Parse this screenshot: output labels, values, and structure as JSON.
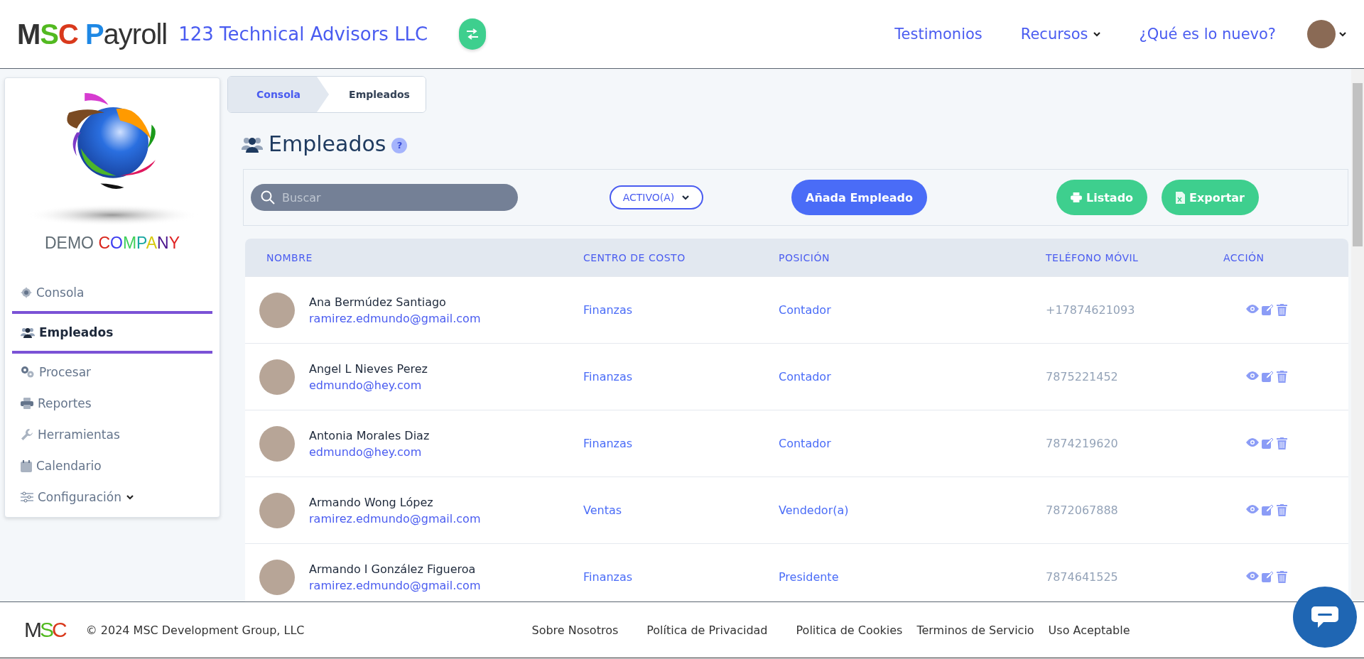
{
  "header": {
    "logo_parts": [
      {
        "text": "M",
        "color": "#333333"
      },
      {
        "text": "S",
        "color": "#52b920"
      },
      {
        "text": "C",
        "color": "#d9391c"
      },
      {
        "text": "P",
        "color": "#1e88e5"
      },
      {
        "text": "ayroll",
        "color": "#333333"
      }
    ],
    "company": "123 Technical Advisors LLC",
    "nav": [
      {
        "label": "Testimonios",
        "has_menu": false
      },
      {
        "label": "Recursos",
        "has_menu": true
      },
      {
        "label": "¿Qué es lo nuevo?",
        "has_menu": false
      }
    ]
  },
  "sidebar": {
    "brand_parts": [
      {
        "text": "DEMO ",
        "color": "#5f6b73"
      },
      {
        "text": "C",
        "color": "#d9251c"
      },
      {
        "text": "O",
        "color": "#3b3bf0"
      },
      {
        "text": "M",
        "color": "#3fcf5a"
      },
      {
        "text": "P",
        "color": "#17a6a0"
      },
      {
        "text": "A",
        "color": "#d7c90e"
      },
      {
        "text": "N",
        "color": "#4a148c"
      },
      {
        "text": "Y",
        "color": "#e02323"
      }
    ],
    "items": [
      {
        "label": "Consola",
        "selected": false,
        "has_submenu": false
      },
      {
        "label": "Empleados",
        "selected": true,
        "has_submenu": false
      },
      {
        "label": "Procesar",
        "selected": false,
        "has_submenu": false
      },
      {
        "label": "Reportes",
        "selected": false,
        "has_submenu": false
      },
      {
        "label": "Herramientas",
        "selected": false,
        "has_submenu": false
      },
      {
        "label": "Calendario",
        "selected": false,
        "has_submenu": false
      },
      {
        "label": "Configuración",
        "selected": false,
        "has_submenu": true
      }
    ]
  },
  "breadcrumb": [
    "Consola",
    "Empleados"
  ],
  "page_title": "Empleados",
  "help": "?",
  "toolbar": {
    "search": {
      "placeholder": "Buscar"
    },
    "status_filter": "ACTIVO(A)",
    "add_button": "Añada Empleado",
    "list_button": "Listado",
    "export_button": "Exportar"
  },
  "table": {
    "columns": [
      "NOMBRE",
      "CENTRO DE COSTO",
      "POSICIÓN",
      "TELÉFONO MÓVIL",
      "ACCIÓN"
    ],
    "rows": [
      {
        "name": "Ana Bermúdez Santiago",
        "email": "ramirez.edmundo@gmail.com",
        "cost_center": "Finanzas",
        "position": "Contador",
        "phone": "+17874621093"
      },
      {
        "name": "Angel L Nieves Perez",
        "email": "edmundo@hey.com",
        "cost_center": "Finanzas",
        "position": "Contador",
        "phone": "7875221452"
      },
      {
        "name": "Antonia Morales Diaz",
        "email": "edmundo@hey.com",
        "cost_center": "Finanzas",
        "position": "Contador",
        "phone": "7874219620"
      },
      {
        "name": "Armando Wong López",
        "email": "ramirez.edmundo@gmail.com",
        "cost_center": "Ventas",
        "position": "Vendedor(a)",
        "phone": "7872067888"
      },
      {
        "name": "Armando I González Figueroa",
        "email": "ramirez.edmundo@gmail.com",
        "cost_center": "Finanzas",
        "position": "Presidente",
        "phone": "7874641525"
      }
    ]
  },
  "footer": {
    "logo_parts": [
      {
        "text": "M",
        "color": "#333333"
      },
      {
        "text": "S",
        "color": "#52b920"
      },
      {
        "text": "C",
        "color": "#d9391c"
      }
    ],
    "copyright": "© 2024 MSC Development Group, LLC",
    "links": [
      "Sobre Nosotros",
      "Política de Privacidad",
      "Politica de Cookies",
      "Terminos de Servicio",
      "Uso Aceptable"
    ]
  }
}
